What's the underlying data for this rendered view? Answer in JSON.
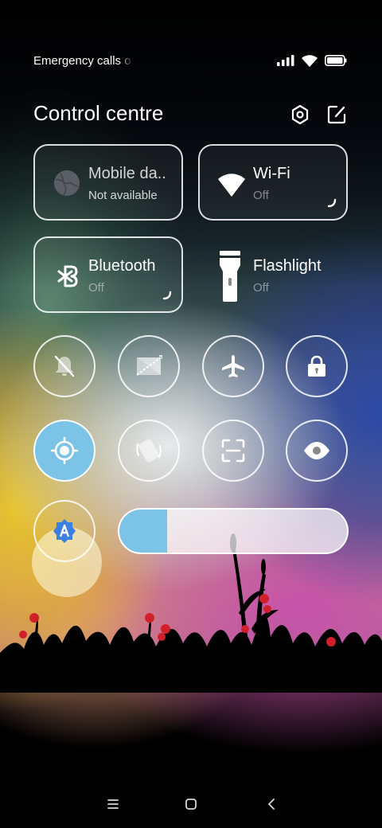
{
  "status_bar": {
    "text": "Emergency calls o",
    "icons": [
      "signal-icon",
      "wifi-icon",
      "battery-icon"
    ]
  },
  "header": {
    "title": "Control centre",
    "buttons": [
      "settings-icon",
      "edit-icon"
    ]
  },
  "tiles": {
    "mobile_data": {
      "title": "Mobile da..",
      "subtitle": "Not available",
      "icon": "globe-icon"
    },
    "wifi": {
      "title": "Wi-Fi",
      "subtitle": "Off",
      "icon": "wifi-icon"
    },
    "bluetooth": {
      "title": "Bluetooth",
      "subtitle": "Off",
      "icon": "bluetooth-icon"
    },
    "flashlight": {
      "title": "Flashlight",
      "subtitle": "Off",
      "icon": "flashlight-icon"
    }
  },
  "toggles_row1": [
    "mute-icon",
    "screenshot-icon",
    "airplane-icon",
    "lock-icon"
  ],
  "toggles_row2": [
    "location-icon",
    "auto-rotate-icon",
    "scanner-icon",
    "reading-mode-icon"
  ],
  "auto_brightness_icon": "auto-brightness-icon",
  "brightness": {
    "level": 0.21
  },
  "navigation": [
    "menu-icon",
    "home-icon",
    "back-icon"
  ],
  "colors": {
    "accent": "#7cc3e8",
    "auto_brightness_icon": "#3b7fe0",
    "subtitle_text": "#9a9a9a"
  }
}
